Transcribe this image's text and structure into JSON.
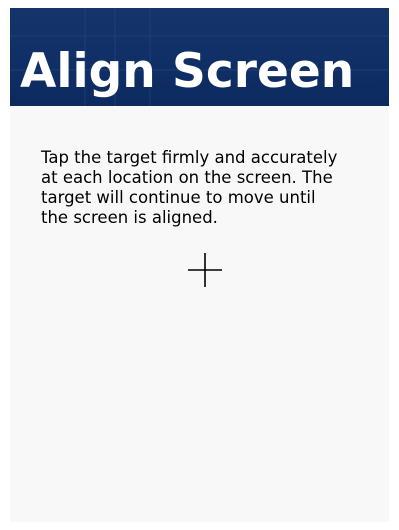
{
  "window": {
    "title": "Align Screen"
  },
  "instructions": {
    "text": "Tap the target firmly and accurately\nat each location on the screen. The\ntarget will continue to move until\nthe screen is aligned."
  },
  "colors": {
    "banner": "#0f2f66",
    "panel_background": "#f8f8f8",
    "text": "#000000",
    "title_text": "#ffffff"
  },
  "icons": {
    "target": "crosshair-target-icon"
  }
}
